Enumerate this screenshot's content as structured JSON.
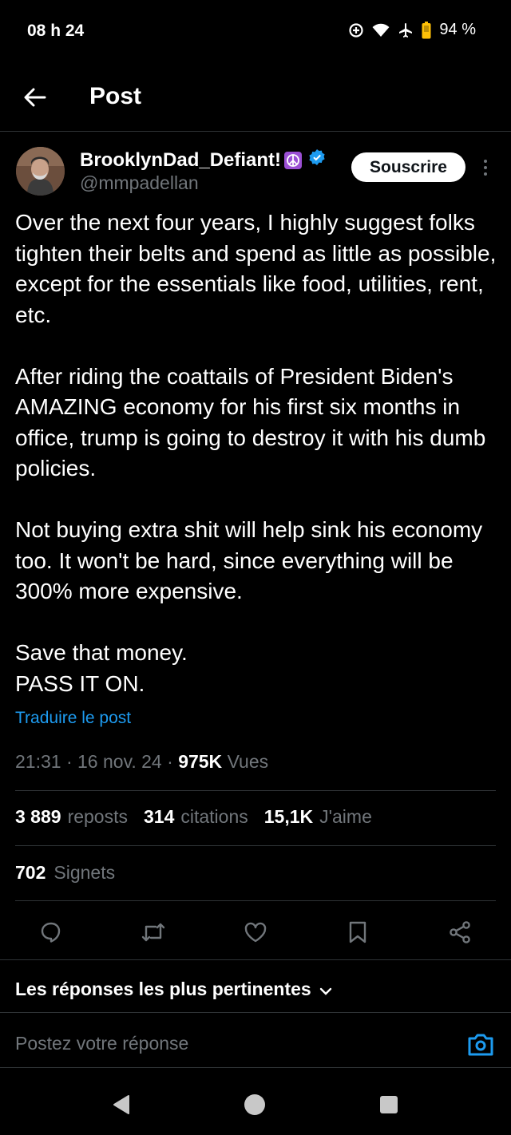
{
  "status_bar": {
    "time": "08 h 24",
    "battery_percent": "94 %",
    "icons": [
      "data-saver-icon",
      "wifi-icon",
      "airplane-icon",
      "battery-icon"
    ]
  },
  "header": {
    "title": "Post",
    "back_icon": "arrow-left-icon"
  },
  "author": {
    "display_name": "BrooklynDad_Defiant!",
    "emoji": "☮",
    "handle": "@mmpadellan",
    "verified": true
  },
  "subscribe_label": "Souscrire",
  "tweet": {
    "paragraphs": [
      "Over the next four years, I highly suggest folks tighten their belts and spend as little as possible, except for the essentials like food, utilities, rent, etc.",
      "After riding the coattails of President Biden's AMAZING economy for his first six months in office, trump is going to destroy it with his dumb policies.",
      "Not buying extra shit will help sink his economy too. It won't be hard, since everything will be 300% more expensive.",
      "Save that money.\nPASS IT ON."
    ],
    "translate_label": "Traduire le post"
  },
  "meta": {
    "time": "21:31",
    "date": "16 nov. 24",
    "views_count": "975K",
    "views_label": "Vues"
  },
  "stats": {
    "reposts_count": "3 889",
    "reposts_label": "reposts",
    "quotes_count": "314",
    "quotes_label": "citations",
    "likes_count": "15,1K",
    "likes_label": "J'aime",
    "bookmarks_count": "702",
    "bookmarks_label": "Signets"
  },
  "actions": [
    "reply-icon",
    "repost-icon",
    "like-icon",
    "bookmark-icon",
    "share-icon"
  ],
  "replies_sort_label": "Les réponses les plus pertinentes",
  "reply_placeholder": "Postez votre réponse",
  "colors": {
    "accent": "#1d9bf0",
    "background": "#000000",
    "secondary_text": "#71767b",
    "divider": "#2f3336"
  }
}
